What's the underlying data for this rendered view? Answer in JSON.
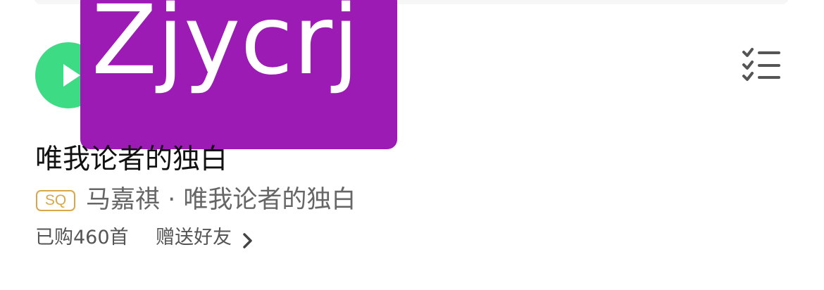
{
  "overlay": {
    "text": "Zjycrj"
  },
  "song": {
    "title": "唯我论者的独白",
    "quality_badge": "SQ",
    "artist_album": "马嘉祺 · 唯我论者的独白",
    "purchased": "已购460首",
    "gift": "赠送好友"
  },
  "icons": {
    "play": "play-icon",
    "queue": "checklist-icon",
    "chevron": "chevron-right-icon"
  },
  "colors": {
    "play_green": "#3ddc84",
    "overlay_purple": "#9c1bb4",
    "sq_gold": "#d7a84a"
  }
}
